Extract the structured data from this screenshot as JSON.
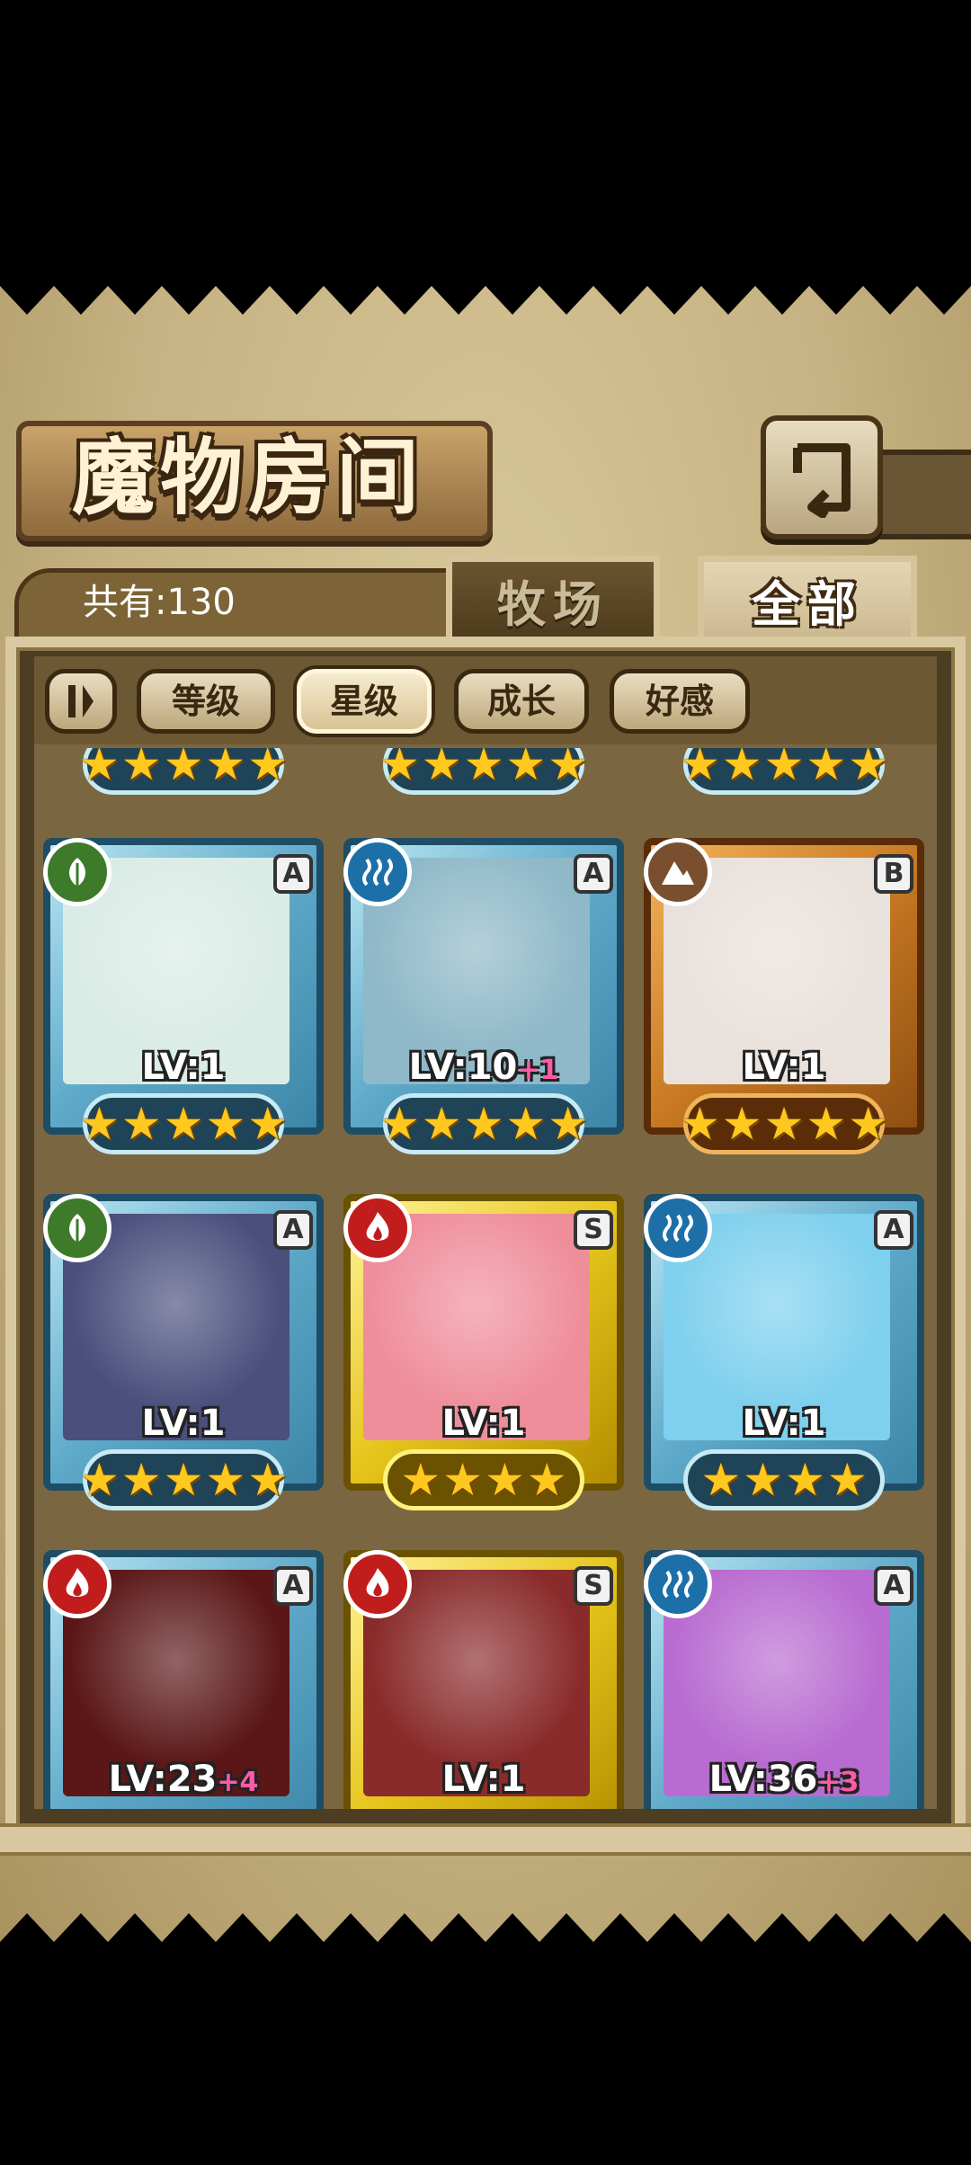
{
  "title": "魔物房间",
  "count_label": "共有:130",
  "tabs": [
    {
      "label": "牧场",
      "active": false
    },
    {
      "label": "全部",
      "active": true
    }
  ],
  "sort_buttons": [
    {
      "label": "等级",
      "active": false
    },
    {
      "label": "星级",
      "active": true
    },
    {
      "label": "成长",
      "active": false
    },
    {
      "label": "好感",
      "active": false
    }
  ],
  "top_partial_row": [
    {
      "stars": 5
    },
    {
      "stars": 5
    },
    {
      "stars": 5
    }
  ],
  "monsters": [
    {
      "element": "wood-icon",
      "rank": "A",
      "level": "LV:1",
      "plus": "",
      "stars": 5,
      "frame": "A",
      "portrait": "#d9ece5"
    },
    {
      "element": "water-icon",
      "rank": "A",
      "level": "LV:10",
      "plus": "+1",
      "stars": 5,
      "frame": "A",
      "portrait": "#8fb8c8"
    },
    {
      "element": "earth-icon",
      "rank": "B",
      "level": "LV:1",
      "plus": "",
      "stars": 5,
      "frame": "B",
      "portrait": "#e9e1dc"
    },
    {
      "element": "wood-icon",
      "rank": "A",
      "level": "LV:1",
      "plus": "",
      "stars": 5,
      "frame": "A",
      "portrait": "#4a4f7c"
    },
    {
      "element": "fire-icon",
      "rank": "S",
      "level": "LV:1",
      "plus": "",
      "stars": 4,
      "frame": "S",
      "portrait": "#ef8e9b"
    },
    {
      "element": "water-icon",
      "rank": "A",
      "level": "LV:1",
      "plus": "",
      "stars": 4,
      "frame": "A",
      "portrait": "#7ed0ee"
    },
    {
      "element": "fire-icon",
      "rank": "A",
      "level": "LV:23",
      "plus": "+4",
      "stars": 0,
      "frame": "A",
      "portrait": "#5b1717"
    },
    {
      "element": "fire-icon",
      "rank": "S",
      "level": "LV:1",
      "plus": "",
      "stars": 0,
      "frame": "S",
      "portrait": "#8a2b2b"
    },
    {
      "element": "water-icon",
      "rank": "A",
      "level": "LV:36",
      "plus": "+3",
      "stars": 0,
      "frame": "A",
      "portrait": "#b86bd0"
    }
  ],
  "colors": {
    "accent": "#7a6742",
    "star": "#ffc81e",
    "plus": "#ff5aa8"
  }
}
